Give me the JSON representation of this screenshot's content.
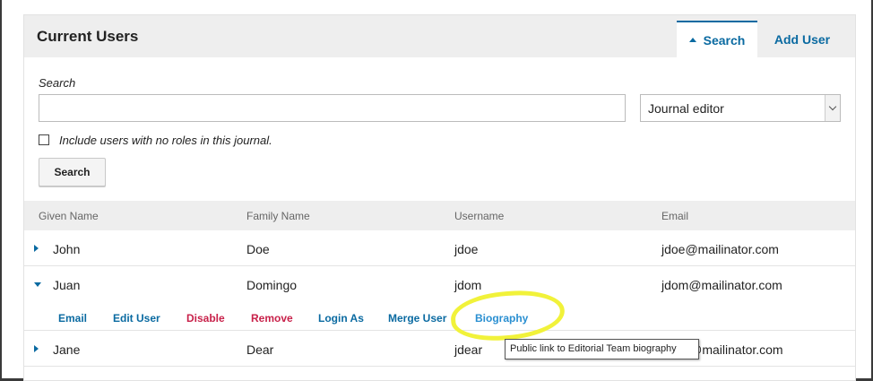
{
  "panel": {
    "title": "Current Users"
  },
  "tabs": {
    "search": "Search",
    "add_user": "Add User"
  },
  "search": {
    "label": "Search",
    "value": "",
    "placeholder": "",
    "role_selected": "Journal editor",
    "checkbox_label": "Include users with no roles in this journal.",
    "button": "Search"
  },
  "table": {
    "headers": [
      "Given Name",
      "Family Name",
      "Username",
      "Email"
    ],
    "rows": [
      {
        "given": "John",
        "family": "Doe",
        "username": "jdoe",
        "email": "jdoe@mailinator.com"
      },
      {
        "given": "Juan",
        "family": "Domingo",
        "username": "jdom",
        "email": "jdom@mailinator.com"
      },
      {
        "given": "Jane",
        "family": "Dear",
        "username": "jdear",
        "email": "jdear@mailinator.com"
      }
    ]
  },
  "actions": {
    "email": "Email",
    "edit_user": "Edit User",
    "disable": "Disable",
    "remove": "Remove",
    "login_as": "Login As",
    "merge_user": "Merge User",
    "biography": "Biography"
  },
  "tooltip": "Public link to Editorial Team biography",
  "colors": {
    "link": "#0a6aa1",
    "danger": "#c8214a",
    "highlight": "#f1f23a"
  },
  "icons": {
    "tab_indicator": "triangle-up-icon",
    "row_collapsed": "triangle-right-icon",
    "row_expanded": "triangle-down-icon",
    "select": "chevron-down-icon"
  }
}
